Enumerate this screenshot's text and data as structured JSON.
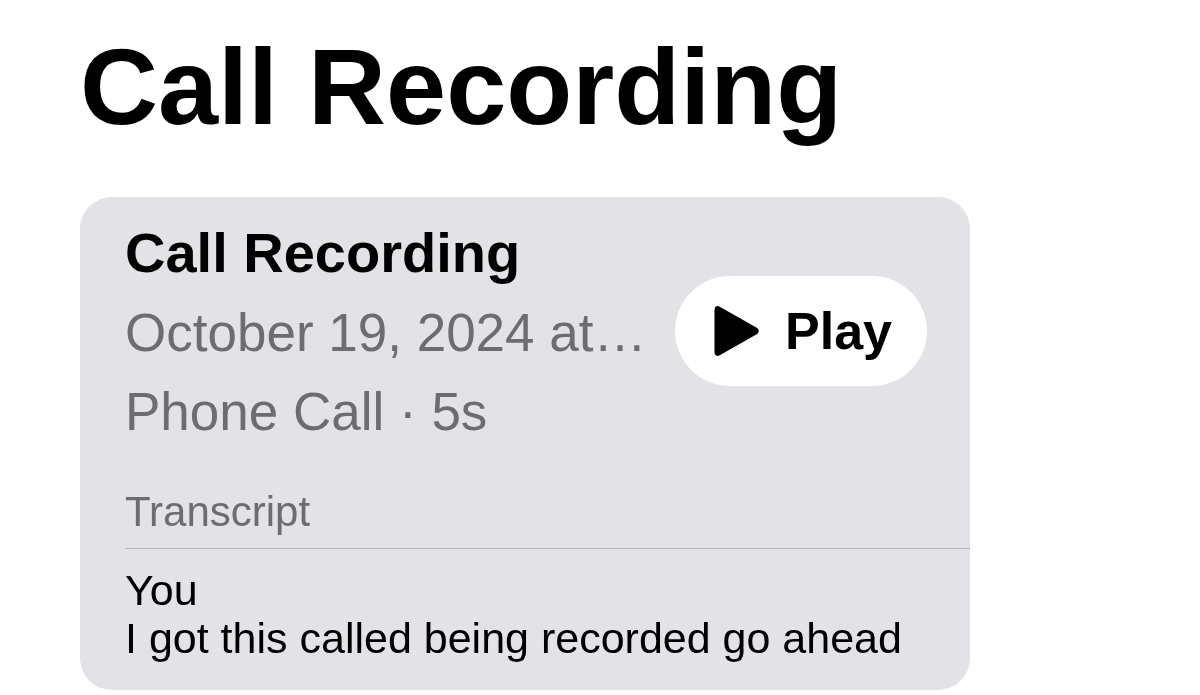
{
  "title": "Call Recording",
  "recording": {
    "title": "Call Recording",
    "date": "October 19, 2024 at…",
    "details": "Phone Call · 5s",
    "play_button": {
      "label": "Play"
    },
    "transcript": {
      "heading": "Transcript",
      "entries": [
        {
          "speaker": "You",
          "text": "I got this called being recorded go ahead"
        }
      ]
    }
  }
}
